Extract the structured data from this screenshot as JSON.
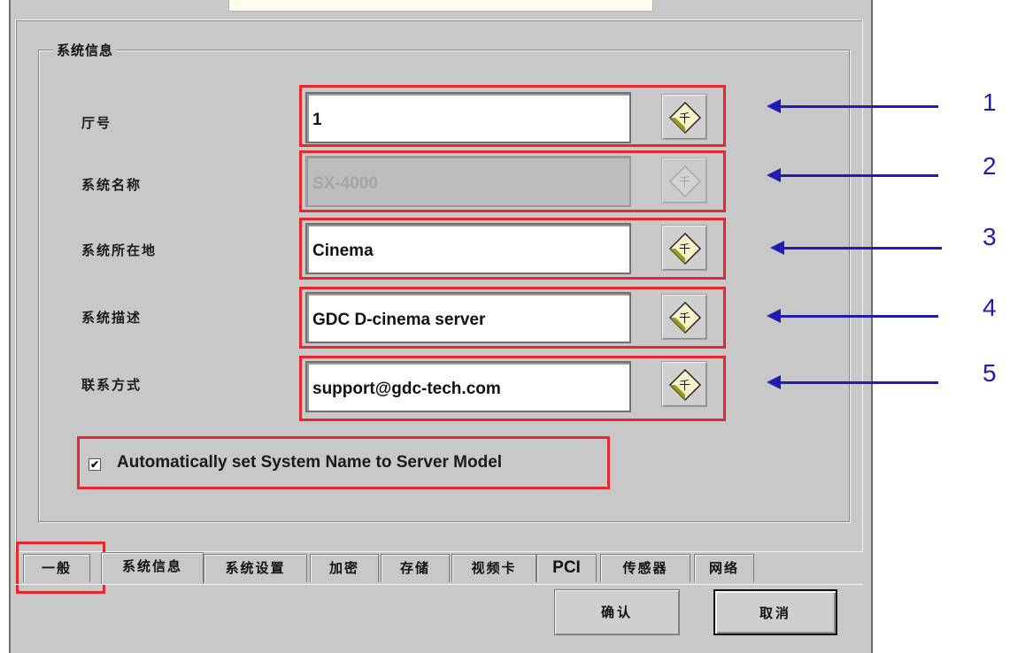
{
  "group_title": "系统信息",
  "fields": [
    {
      "label": "厅号",
      "value": "1",
      "enabled": true,
      "callout": "1"
    },
    {
      "label": "系统名称",
      "value": "SX-4000",
      "enabled": false,
      "callout": "2"
    },
    {
      "label": "系统所在地",
      "value": "Cinema",
      "enabled": true,
      "callout": "3"
    },
    {
      "label": "系统描述",
      "value": "GDC D-cinema server",
      "enabled": true,
      "callout": "4"
    },
    {
      "label": "联系方式",
      "value": "support@gdc-tech.com",
      "enabled": true,
      "callout": "5"
    }
  ],
  "auto_name": {
    "checked": true,
    "check_glyph": "✔",
    "label": "Automatically set System Name to Server Model"
  },
  "tabs": [
    "一般",
    "系统信息",
    "系统设置",
    "加密",
    "存储",
    "视频卡",
    "PCI",
    "传感器",
    "网络"
  ],
  "active_tab": "系统信息",
  "buttons": {
    "confirm": "确认",
    "cancel": "取消"
  },
  "colors": {
    "highlight": "#e8262d",
    "callout": "#1f1cb5"
  },
  "icons": {
    "keyboard_button": "keyboard-icon"
  }
}
